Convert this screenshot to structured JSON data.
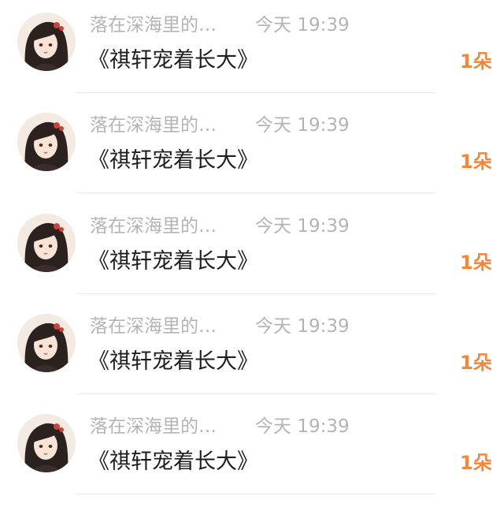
{
  "entries": [
    {
      "username": "落在深海里的…",
      "time": "今天 19:39",
      "message": "《祺轩宠着长大》",
      "count": "1朵",
      "avatar_icon": "anime-girl-avatar"
    },
    {
      "username": "落在深海里的…",
      "time": "今天 19:39",
      "message": "《祺轩宠着长大》",
      "count": "1朵",
      "avatar_icon": "anime-girl-avatar"
    },
    {
      "username": "落在深海里的…",
      "time": "今天 19:39",
      "message": "《祺轩宠着长大》",
      "count": "1朵",
      "avatar_icon": "anime-girl-avatar"
    },
    {
      "username": "落在深海里的…",
      "time": "今天 19:39",
      "message": "《祺轩宠着长大》",
      "count": "1朵",
      "avatar_icon": "anime-girl-avatar"
    },
    {
      "username": "落在深海里的…",
      "time": "今天 19:39",
      "message": "《祺轩宠着长大》",
      "count": "1朵",
      "avatar_icon": "anime-girl-avatar"
    }
  ],
  "colors": {
    "meta_text": "#b4b4b4",
    "message_text": "#1e1e1e",
    "count_accent": "#f0873a",
    "separator": "#ececec"
  }
}
